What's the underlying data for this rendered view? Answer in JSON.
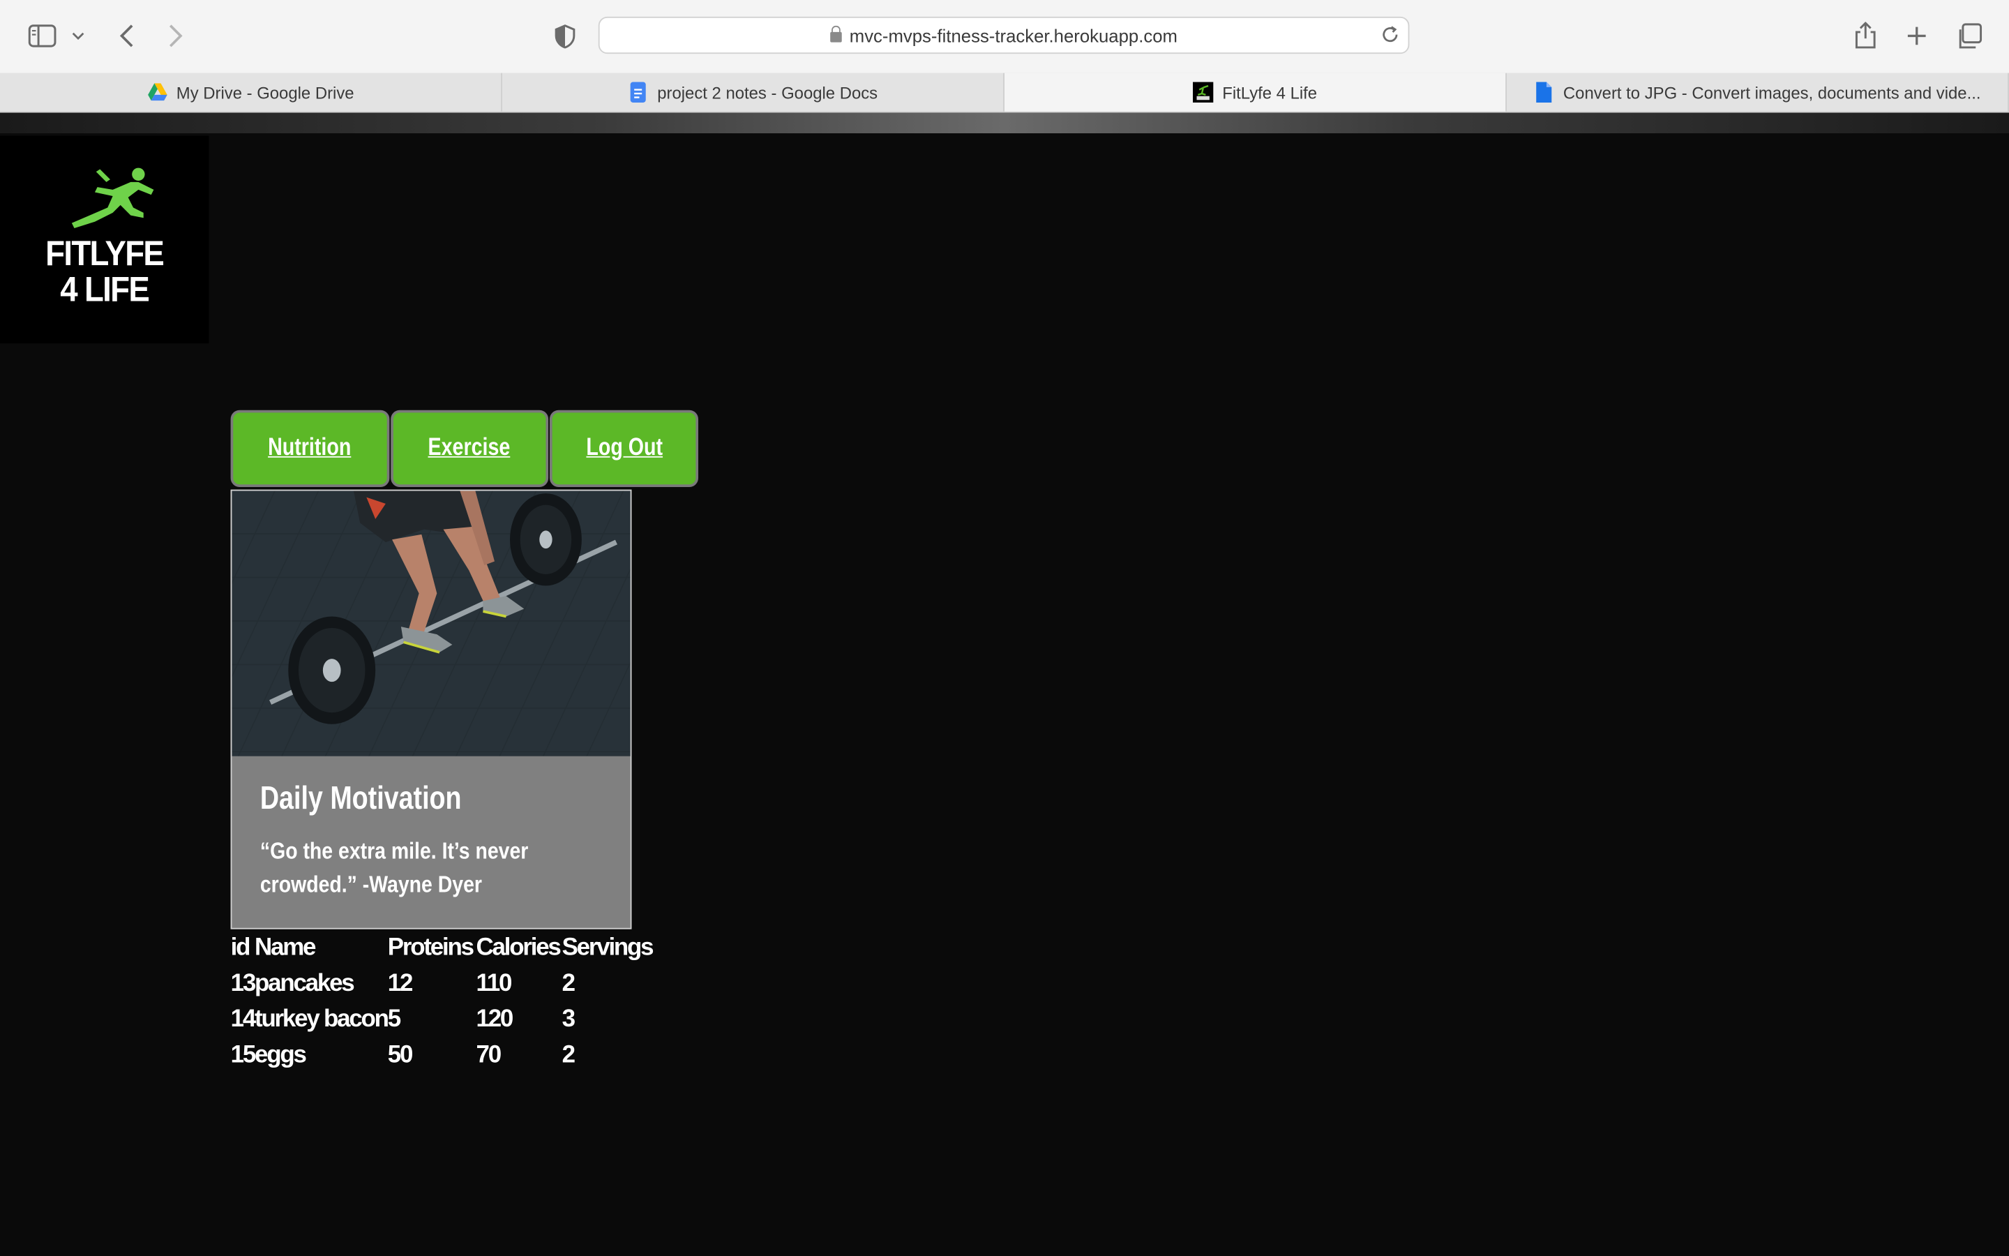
{
  "browser": {
    "url": "mvc-mvps-fitness-tracker.herokuapp.com",
    "tabs": [
      {
        "label": "My Drive - Google Drive",
        "icon": "google-drive-icon",
        "active": false
      },
      {
        "label": "project 2 notes - Google Docs",
        "icon": "google-docs-icon",
        "active": false
      },
      {
        "label": "FitLyfe 4 Life",
        "icon": "fitlyfe-favicon",
        "active": true
      },
      {
        "label": "Convert to JPG - Convert images, documents and vide...",
        "icon": "document-icon",
        "active": false
      }
    ]
  },
  "site": {
    "logo_line1": "FITLYFE",
    "logo_line2": "4 LIFE",
    "accent_color": "#5cb827"
  },
  "nav": {
    "nutrition": "Nutrition",
    "exercise": "Exercise",
    "logout": "Log Out"
  },
  "card": {
    "title": "Daily Motivation",
    "quote": "“Go the extra mile. It’s never crowded.” -Wayne Dyer"
  },
  "table": {
    "headers": [
      "id",
      "Name",
      "Proteins",
      "Calories",
      "Servings"
    ],
    "rows": [
      [
        "13",
        "pancakes",
        "12",
        "110",
        "2"
      ],
      [
        "14",
        "turkey bacon",
        "5",
        "120",
        "3"
      ],
      [
        "15",
        "eggs",
        "50",
        "70",
        "2"
      ]
    ]
  }
}
